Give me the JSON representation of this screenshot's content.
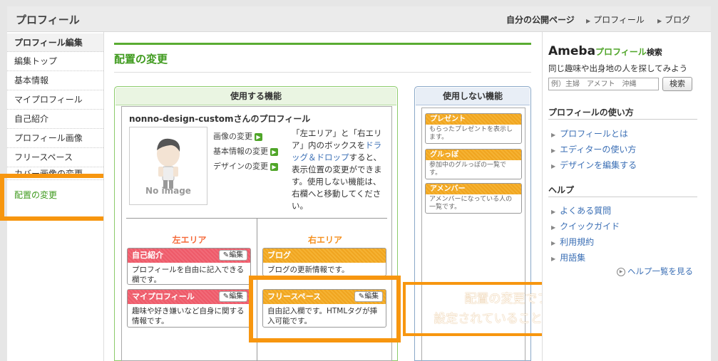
{
  "topbar": {
    "title": "プロフィール",
    "my_public_page": "自分の公開ページ",
    "nav_profile": "プロフィール",
    "nav_blog": "ブログ"
  },
  "sidebar": {
    "heading": "プロフィール編集",
    "items": [
      "編集トップ",
      "基本情報",
      "マイプロフィール",
      "自己紹介",
      "プロフィール画像",
      "フリースペース",
      "カバー画像の変更",
      "配置の変更"
    ]
  },
  "main": {
    "title": "配置の変更",
    "used_header": "使用する機能",
    "unused_header": "使用しない機能",
    "profile_name": "nonno-design-customさんのプロフィール",
    "no_image": "No image",
    "links": [
      "画像の変更",
      "基本情報の変更",
      "デザインの変更"
    ],
    "instruction_a": "「左エリア」と「右エリア」内のボックスを",
    "instruction_link": "ドラッグ＆ドロップ",
    "instruction_b": "すると、表示位置の変更ができます。使用しない機能は、右欄へと移動してください。",
    "left_area": "左エリア",
    "right_area": "右エリア",
    "edit_label": "編集",
    "left_cards": [
      {
        "title": "自己紹介",
        "desc": "プロフィールを自由に記入できる欄です。"
      },
      {
        "title": "マイプロフィール",
        "desc": "趣味や好き嫌いなど自身に関する情報です。"
      }
    ],
    "right_cards": [
      {
        "title": "ブログ",
        "desc": "ブログの更新情報です。"
      },
      {
        "title": "フリースペース",
        "desc": "自由記入欄です。HTMLタグが挿入可能です。"
      }
    ],
    "unused_cards": [
      {
        "title": "プレゼント",
        "desc": "もらったプレゼントを表示します。"
      },
      {
        "title": "グルっぽ",
        "desc": "参加中のグルっぽの一覧です。"
      },
      {
        "title": "アメンバー",
        "desc": "アメンバーになっている人の一覧です。"
      }
    ]
  },
  "callout": {
    "line1": "配置の変更でフリースペースが",
    "line2": "設定されていることを確認してください。"
  },
  "right": {
    "logo_ameba": "Ameba",
    "logo_profile": "プロフィール",
    "logo_search": "検索",
    "search_desc": "同じ趣味や出身地の人を探してみよう",
    "search_placeholder": "例）主婦　アメフト　沖縄",
    "search_button": "検索",
    "howto_title": "プロフィールの使い方",
    "howto_links": [
      "プロフィールとは",
      "エディターの使い方",
      "デザインを編集する"
    ],
    "help_title": "ヘルプ",
    "help_links": [
      "よくある質問",
      "クイックガイド",
      "利用規約",
      "用語集"
    ],
    "help_all": "ヘルプ一覧を見る"
  },
  "colors": {
    "accent_green": "#5aac32",
    "highlight_orange": "#f7960f",
    "card_red": "#ee5a69",
    "card_orange": "#f0a520"
  }
}
